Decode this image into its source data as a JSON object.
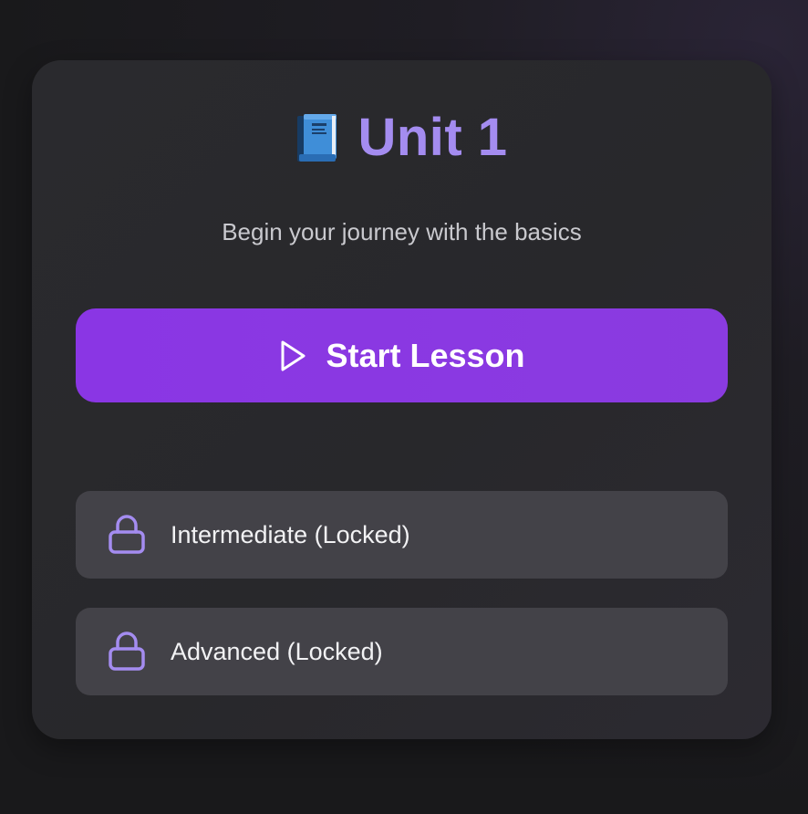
{
  "unit": {
    "title": "Unit 1",
    "subtitle": "Begin your journey with the basics",
    "title_icon": "blue-book-icon"
  },
  "start_button": {
    "label": "Start Lesson",
    "icon": "play-icon"
  },
  "locked_levels": [
    {
      "label": "Intermediate (Locked)",
      "icon": "lock-icon"
    },
    {
      "label": "Advanced (Locked)",
      "icon": "lock-icon"
    }
  ],
  "colors": {
    "accent": "#a48cf0",
    "button": "#8a36e4",
    "card": "#28282b",
    "locked_item": "#434248",
    "background": "#19191b"
  }
}
